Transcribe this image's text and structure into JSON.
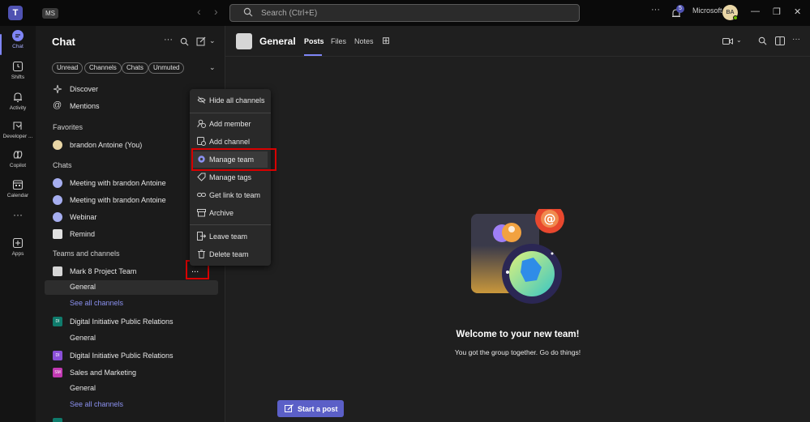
{
  "titlebar": {
    "app_icon": "teams-logo-icon",
    "account_badge": "MS",
    "search_placeholder": "Search (Ctrl+E)",
    "notification_count": "5",
    "org_name": "Microsoft",
    "avatar_initials": "BA"
  },
  "rail": {
    "items": [
      {
        "label": "Chat",
        "icon": "chat-icon",
        "active": true
      },
      {
        "label": "Shifts",
        "icon": "shifts-icon"
      },
      {
        "label": "Activity",
        "icon": "bell-icon"
      },
      {
        "label": "Developer ...",
        "icon": "developer-icon"
      },
      {
        "label": "Copilot",
        "icon": "copilot-icon"
      },
      {
        "label": "Calendar",
        "icon": "calendar-icon"
      },
      {
        "label": "Apps",
        "icon": "apps-icon"
      }
    ]
  },
  "panel": {
    "title": "Chat",
    "filters": [
      "Unread",
      "Channels",
      "Chats",
      "Unmuted"
    ],
    "top_items": [
      "Discover",
      "Mentions"
    ],
    "favorites_header": "Favorites",
    "favorites": [
      "brandon Antoine (You)"
    ],
    "chats_header": "Chats",
    "chats": [
      "Meeting with brandon Antoine",
      "Meeting with brandon Antoine",
      "Webinar",
      "Remind"
    ],
    "teams_header": "Teams and channels",
    "teams": [
      {
        "name": "Mark 8 Project Team",
        "channels": [
          "General"
        ],
        "see_all": "See all channels"
      },
      {
        "name": "Digital Initiative Public Relations",
        "badge": "DI",
        "channels": [
          "General"
        ]
      },
      {
        "name": "Digital Initiative Public Relations",
        "badge": "DI",
        "channels": []
      },
      {
        "name": "Sales and Marketing",
        "badge": "SM",
        "channels": [
          "General"
        ],
        "see_all": "See all channels"
      }
    ],
    "more_button": "..."
  },
  "menu": {
    "items": [
      {
        "label": "Hide all channels",
        "icon": "eye-off-icon"
      },
      {
        "label": "Add member",
        "icon": "add-person-icon"
      },
      {
        "label": "Add channel",
        "icon": "add-channel-icon"
      },
      {
        "label": "Manage team",
        "icon": "gear-icon"
      },
      {
        "label": "Manage tags",
        "icon": "tag-icon"
      },
      {
        "label": "Get link to team",
        "icon": "link-icon"
      },
      {
        "label": "Archive",
        "icon": "archive-icon"
      },
      {
        "label": "Leave team",
        "icon": "leave-icon"
      },
      {
        "label": "Delete team",
        "icon": "trash-icon"
      }
    ]
  },
  "main": {
    "channel_title": "General",
    "tabs": [
      "Posts",
      "Files",
      "Notes"
    ],
    "welcome_title": "Welcome to your new team!",
    "welcome_subtitle": "You got the group together. Go do things!",
    "start_post": "Start a post"
  },
  "colors": {
    "accent": "#5b5fc7",
    "highlight_box": "#d80000"
  }
}
